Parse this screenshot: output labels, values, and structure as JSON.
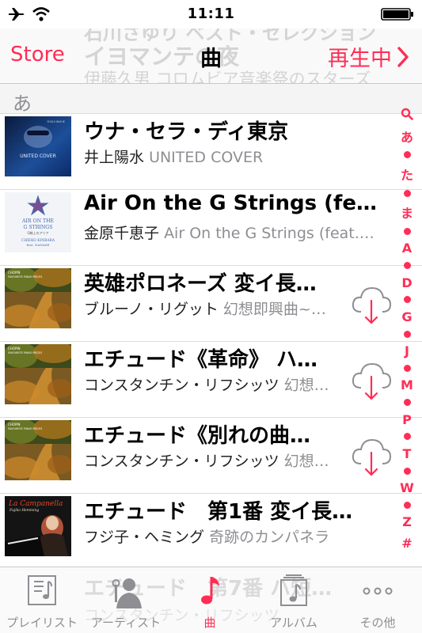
{
  "status_bar": {
    "time": "11:11"
  },
  "nav": {
    "store_label": "Store",
    "title": "曲",
    "now_playing_label": "再生中",
    "ghost": {
      "line1": "石川さゆり ベスト・セレクション",
      "line2": "イヨマンテの夜",
      "line3": "伊藤久男 コロムビア音楽祭のスターズ"
    }
  },
  "section": {
    "header": "あ"
  },
  "songs": [
    {
      "title": "ウナ・セラ・ディ東京",
      "artist": "井上陽水",
      "album": "UNITED COVER",
      "cloud": false
    },
    {
      "title": "Air On the G Strings (feat.…",
      "artist": "金原千恵子",
      "album": "Air On the G Strings (feat.…",
      "cloud": false
    },
    {
      "title": "英雄ポロネーズ 変イ長…",
      "artist": "ブルーノ・リグット",
      "album": "幻想即興曲~…",
      "cloud": true
    },
    {
      "title": "エチュード《革命》 ハ…",
      "artist": "コンスタンチン・リフシッツ",
      "album": "幻想…",
      "cloud": true
    },
    {
      "title": "エチュード《別れの曲…",
      "artist": "コンスタンチン・リフシッツ",
      "album": "幻想…",
      "cloud": true
    },
    {
      "title": "エチュード　第1番 変イ長…",
      "artist": "フジ子・ヘミング",
      "album": "奇跡のカンパネラ",
      "cloud": false
    }
  ],
  "covers": {
    "united_cover": {
      "text": "UNITED COVER",
      "small": "YOSUI INOUE"
    },
    "air_g": {
      "line1": "AIR ON THE",
      "line2": "G STRINGS",
      "line3": "G線上のアリア",
      "line4": "CHIEKO KINBARA",
      "line5": "feat. NANASE"
    },
    "chopin": {
      "line1": "CHOPIN",
      "line2": "FAVOURITE PIANO PIECES"
    },
    "campanella": {
      "line1": "La Campanella",
      "line2": "Fujiko Hemming"
    }
  },
  "index_bar": {
    "items": [
      "Q",
      "あ",
      "•",
      "た",
      "•",
      "ま",
      "•",
      "A",
      "•",
      "D",
      "•",
      "G",
      "•",
      "J",
      "•",
      "M",
      "•",
      "P",
      "•",
      "T",
      "•",
      "W",
      "•",
      "Z",
      "#"
    ]
  },
  "tab_bar": {
    "ghost_title": "エチュード　第7番 ハ短…",
    "ghost_meta": "コンスタンチン・リフシッツ",
    "tabs": [
      {
        "label": "プレイリスト",
        "icon": "playlist-icon",
        "active": false
      },
      {
        "label": "アーティスト",
        "icon": "artist-icon",
        "active": false
      },
      {
        "label": "曲",
        "icon": "music-note-icon",
        "active": true
      },
      {
        "label": "アルバム",
        "icon": "album-icon",
        "active": false
      },
      {
        "label": "その他",
        "icon": "more-icon",
        "active": false
      }
    ]
  },
  "colors": {
    "accent": "#ff2d55",
    "secondary_text": "#8e8e93",
    "separator": "#dcdcdc"
  }
}
